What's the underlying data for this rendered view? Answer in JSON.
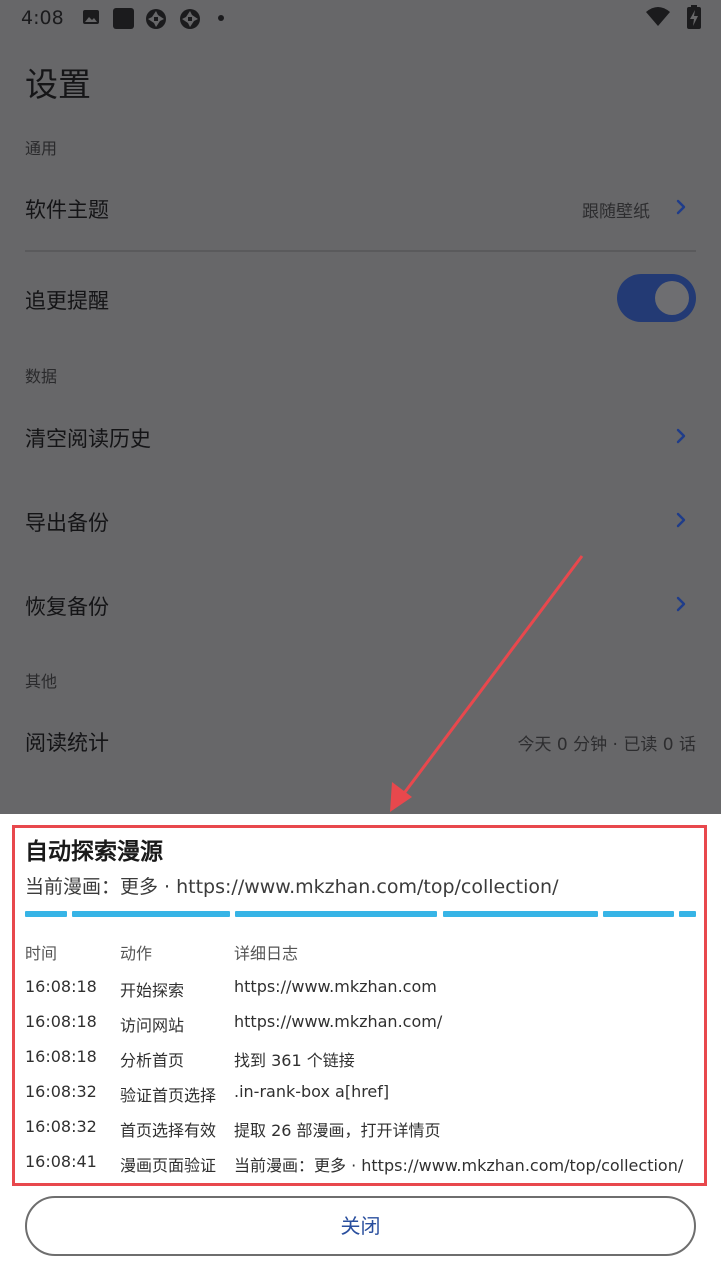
{
  "status_bar": {
    "time": "4:08",
    "icons": [
      "image-icon",
      "square-app-icon",
      "aperture-icon",
      "aperture-icon",
      "dot-icon"
    ],
    "right_icons": [
      "wifi-icon",
      "battery-charging-icon"
    ]
  },
  "settings": {
    "title": "设置",
    "sections": {
      "general": "通用",
      "data": "数据",
      "other": "其他"
    },
    "theme": {
      "label": "软件主题",
      "value": "跟随壁纸"
    },
    "update_reminder": {
      "label": "追更提醒",
      "enabled": true
    },
    "clear_history": {
      "label": "清空阅读历史"
    },
    "export_backup": {
      "label": "导出备份"
    },
    "restore_backup": {
      "label": "恢复备份"
    },
    "reading_stats": {
      "label": "阅读统计",
      "value": "今天 0 分钟 · 已读 0 话"
    }
  },
  "sheet": {
    "title": "自动探索漫源",
    "subtitle": "当前漫画：更多 · https://www.mkzhan.com/top/collection/",
    "columns": {
      "time": "时间",
      "action": "动作",
      "detail": "详细日志"
    },
    "rows": [
      {
        "time": "16:08:18",
        "action": "开始探索",
        "detail": "https://www.mkzhan.com"
      },
      {
        "time": "16:08:18",
        "action": "访问网站",
        "detail": "https://www.mkzhan.com/"
      },
      {
        "time": "16:08:18",
        "action": "分析首页",
        "detail": "找到 361 个链接"
      },
      {
        "time": "16:08:32",
        "action": "验证首页选择",
        "detail": ".in-rank-box a[href]"
      },
      {
        "time": "16:08:32",
        "action": "首页选择有效",
        "detail": "提取 26 部漫画，打开详情页"
      },
      {
        "time": "16:08:41",
        "action": "漫画页面验证",
        "detail": "当前漫画：更多 · https://www.mkzhan.com/top/collection/"
      }
    ],
    "close_label": "关闭"
  },
  "colors": {
    "accent": "#2a4f9e",
    "progress": "#37b4e6",
    "annotation": "#e8484d",
    "scrim": "#676769"
  }
}
